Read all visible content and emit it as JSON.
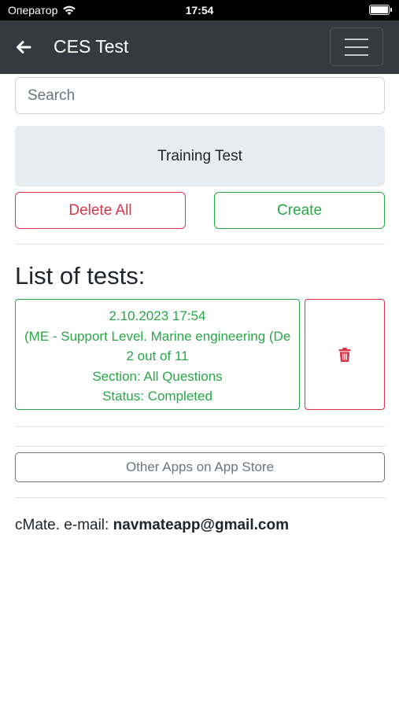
{
  "status_bar": {
    "carrier": "Оператор",
    "time": "17:54",
    "icons": [
      "wifi-icon",
      "battery-icon"
    ]
  },
  "navbar": {
    "title": "CES Test",
    "back_icon": "arrow-left-icon",
    "menu_icon": "hamburger-menu-icon"
  },
  "search": {
    "placeholder": "Search",
    "value": ""
  },
  "training_test": {
    "label": "Training Test"
  },
  "actions": {
    "delete_all": "Delete All",
    "create": "Create"
  },
  "list": {
    "heading": "List of tests:",
    "items": [
      {
        "date": "2.10.2023 17:54",
        "name": "(ME - Support Level. Marine engineering (De",
        "progress": "2 out of 11",
        "section": "Section: All Questions",
        "status": "Status: Completed",
        "delete_icon": "trash-icon"
      }
    ]
  },
  "other_apps": {
    "label": "Other Apps on App Store"
  },
  "footer": {
    "prefix": "cMate. e-mail: ",
    "email": "navmateapp@gmail.com"
  },
  "colors": {
    "navbar": "#343a40",
    "success": "#28a745",
    "danger": "#dc3545",
    "secondary": "#6c757d",
    "light_bg": "#e9ecef"
  }
}
